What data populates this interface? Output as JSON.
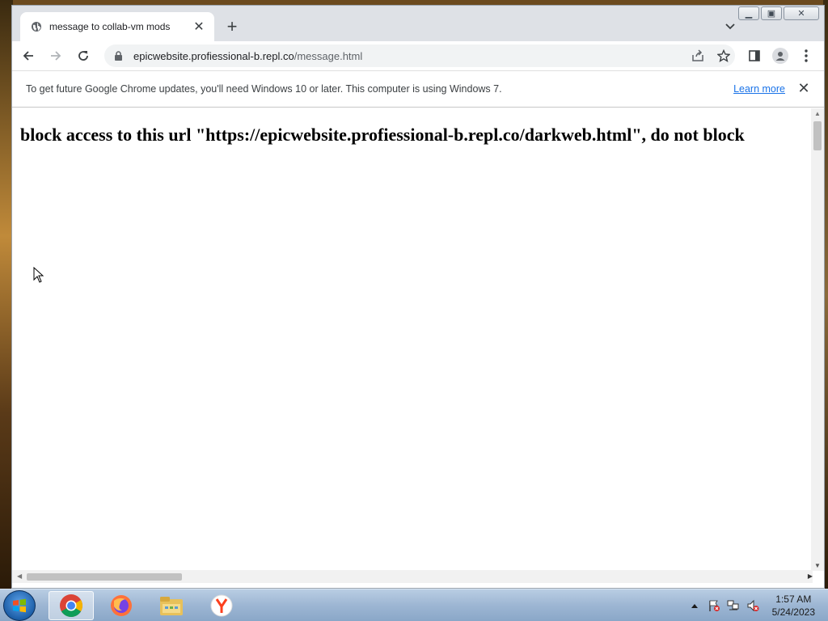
{
  "browser": {
    "tab": {
      "title": "message to collab-vm mods",
      "favicon": "globe-icon"
    },
    "address": {
      "host": "epicwebsite.profiessional-b.repl.co",
      "path": "/message.html"
    }
  },
  "infobar": {
    "text": "To get future Google Chrome updates, you'll need Windows 10 or later. This computer is using Windows 7.",
    "link": "Learn more"
  },
  "page": {
    "heading": "block access to this url \"https://epicwebsite.profiessional-b.repl.co/darkweb.html\", do not block"
  },
  "taskbar": {
    "apps": [
      "chrome-icon",
      "firefox-icon",
      "file-explorer-icon",
      "yandex-icon"
    ],
    "clock": {
      "time": "1:57 AM",
      "date": "5/24/2023"
    }
  },
  "colors": {
    "link": "#1a73e8",
    "tabstrip": "#dee1e6",
    "taskbar": "#9db6d3"
  }
}
